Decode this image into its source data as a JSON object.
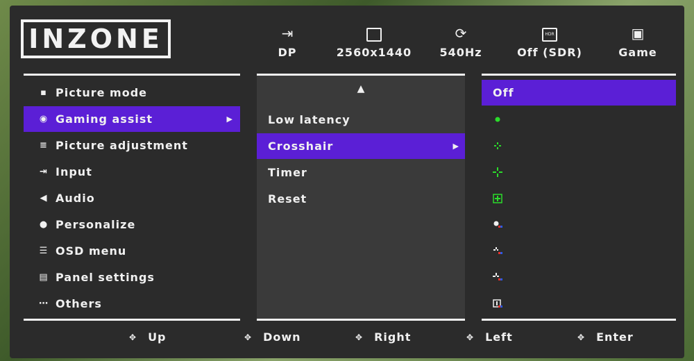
{
  "brand": "INZONE",
  "status_bar": [
    {
      "icon": "input-icon",
      "label": "DP"
    },
    {
      "icon": "resolution-icon",
      "label": "2560x1440"
    },
    {
      "icon": "refresh-icon",
      "label": "540Hz"
    },
    {
      "icon": "hdr-icon",
      "icon_text": "HDR",
      "label": "Off (SDR)"
    },
    {
      "icon": "picture-icon",
      "label": "Game"
    }
  ],
  "menu": [
    {
      "icon": "picture-mode-icon",
      "label": "Picture mode"
    },
    {
      "icon": "gamepad-icon",
      "label": "Gaming assist",
      "selected": true
    },
    {
      "icon": "adjust-icon",
      "label": "Picture adjustment"
    },
    {
      "icon": "input-icon",
      "label": "Input"
    },
    {
      "icon": "speaker-icon",
      "label": "Audio"
    },
    {
      "icon": "person-icon",
      "label": "Personalize"
    },
    {
      "icon": "list-icon",
      "label": "OSD menu"
    },
    {
      "icon": "panel-icon",
      "label": "Panel settings"
    },
    {
      "icon": "dots-icon",
      "label": "Others"
    }
  ],
  "submenu": [
    {
      "label": "Low latency"
    },
    {
      "label": "Crosshair",
      "selected": true
    },
    {
      "label": "Timer"
    },
    {
      "label": "Reset"
    }
  ],
  "options": {
    "selected_label": "Off",
    "crosshairs": [
      "green-dot",
      "green-small-cross",
      "green-large-cross",
      "green-boxed-cross",
      "white-dot-color",
      "white-small-cross-color",
      "white-large-cross-color",
      "white-boxed-cross-color"
    ]
  },
  "footer": [
    {
      "label": "Up"
    },
    {
      "label": "Down"
    },
    {
      "label": "Right"
    },
    {
      "label": "Left"
    },
    {
      "label": "Enter"
    }
  ],
  "colors": {
    "accent": "#5b1fd6",
    "panel": "#2b2b2b",
    "crosshair_green": "#2bdc2b"
  }
}
